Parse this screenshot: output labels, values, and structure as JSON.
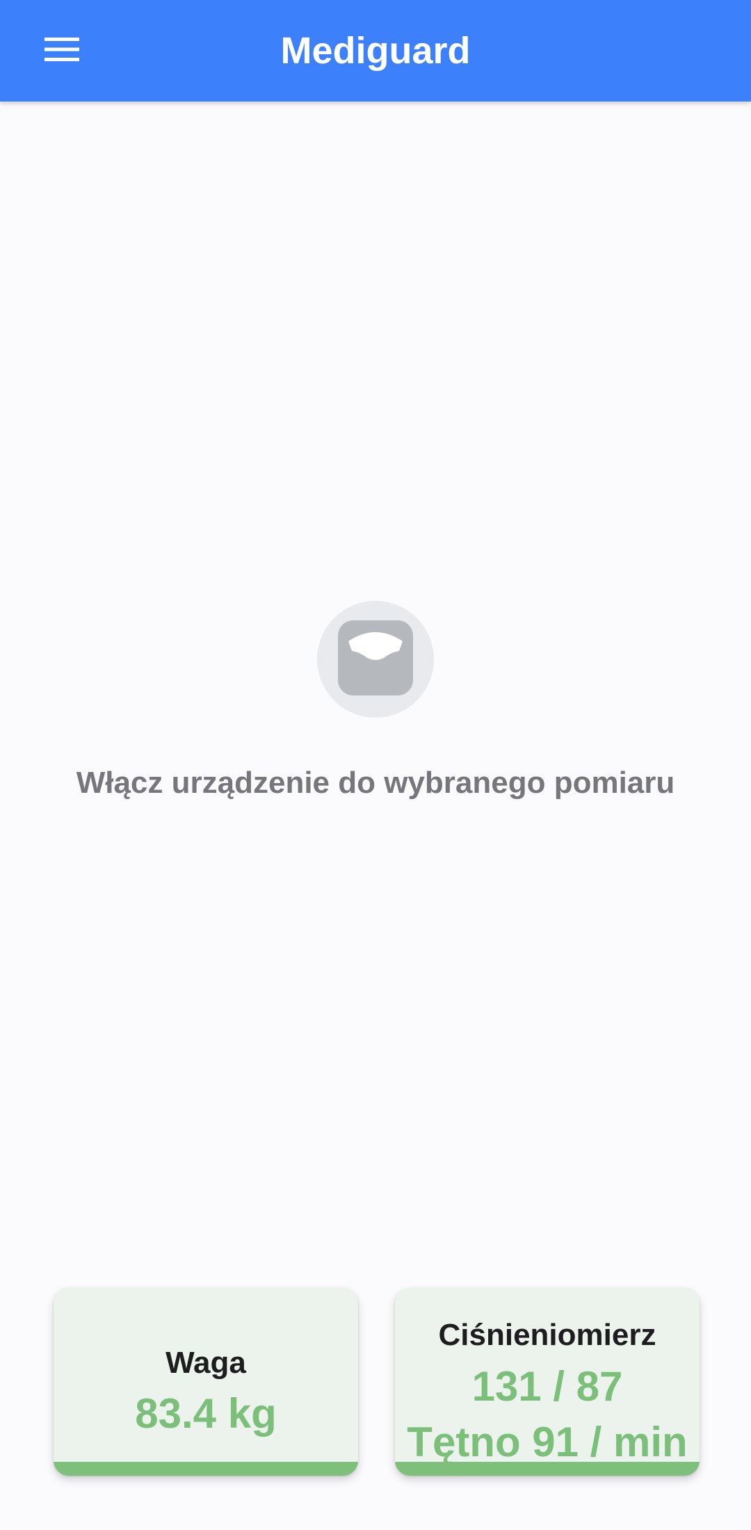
{
  "app_bar": {
    "title": "Mediguard",
    "menu_icon": "menu-icon",
    "background": "#3d80fc"
  },
  "empty_state": {
    "icon": "scale-icon",
    "message": "Włącz urządzenie do wybranego pomiaru"
  },
  "cards": {
    "weight": {
      "title": "Waga",
      "value": "83.4 kg"
    },
    "blood_pressure": {
      "title": "Ciśnieniomierz",
      "value": "131 / 87",
      "pulse": "Tętno 91 / min"
    }
  },
  "colors": {
    "accent_green": "#7cbf7b",
    "card_background": "#ebf3ec",
    "muted_text": "#76777c"
  }
}
